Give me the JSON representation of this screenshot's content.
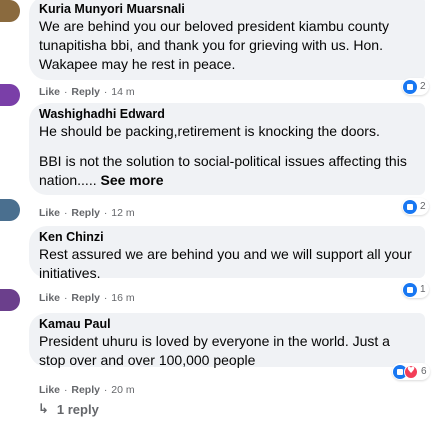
{
  "comments": [
    {
      "author": "Kuria Munyori Muarsnali",
      "text": [
        "We are behind you our beloved president kiambu county tunapitisha bbi, and thank you for grieving with us. Hon. Wakapee may he rest in peace."
      ],
      "actions": {
        "like": "Like",
        "reply": "Reply",
        "time": "14 m"
      },
      "reaction_count": "2",
      "avatar_color": "#8a6a3e"
    },
    {
      "author": "Washighadhi Edward",
      "text": [
        "He should be packing,retirement is knocking the doors.",
        "BBI is not the solution to social-political issues affecting this nation....."
      ],
      "see_more": "See more",
      "actions": {
        "like": "Like",
        "reply": "Reply",
        "time": "12 m"
      },
      "reaction_count": "2",
      "avatar_color": "#7a3fa8"
    },
    {
      "author": "Ken Chinzi",
      "text": [
        "Rest assured we are behind you and we will support all your initiatives."
      ],
      "actions": {
        "like": "Like",
        "reply": "Reply",
        "time": "16 m"
      },
      "reaction_count": "1",
      "avatar_color": "#4a6f8f"
    },
    {
      "author": "Kamau Paul",
      "text": [
        "President uhuru is loved by everyone in the world. Just a stop over and over 100,000 people"
      ],
      "actions": {
        "like": "Like",
        "reply": "Reply",
        "time": "20 m"
      },
      "reaction_count": "6",
      "avatar_color": "#6b3f8c"
    }
  ],
  "reply_link": "1 reply",
  "separator": "·"
}
